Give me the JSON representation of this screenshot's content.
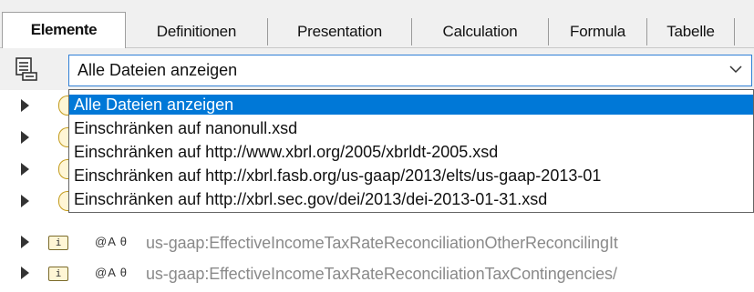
{
  "tabs": [
    {
      "label": "Elemente",
      "active": true
    },
    {
      "label": "Definitionen"
    },
    {
      "label": "Presentation"
    },
    {
      "label": "Calculation"
    },
    {
      "label": "Formula"
    },
    {
      "label": "Tabelle"
    }
  ],
  "filter": {
    "icon": "filter-list-icon",
    "selected": "Alle Dateien anzeigen",
    "options": [
      "Alle Dateien anzeigen",
      "Einschränken auf nanonull.xsd",
      "Einschränken auf http://www.xbrl.org/2005/xbrldt-2005.xsd",
      "Einschränken auf http://xbrl.fasb.org/us-gaap/2013/elts/us-gaap-2013-01",
      "Einschränken auf http://xbrl.sec.gov/dei/2013/dei-2013-01-31.xsd"
    ]
  },
  "list": {
    "rows": [
      {
        "symbols": "@A θ",
        "concept": "us-gaap:EffectiveIncomeTaxRateReconciliationOtherReconcilingIt"
      },
      {
        "symbols": "@A θ",
        "concept": "us-gaap:EffectiveIncomeTaxRateReconciliationTaxContingencies/"
      }
    ]
  },
  "colors": {
    "accent": "#0078d7",
    "border_focus": "#2f7fd6"
  }
}
